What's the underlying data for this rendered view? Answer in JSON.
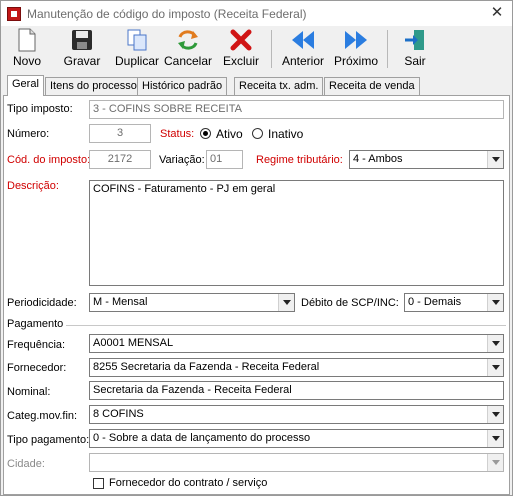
{
  "window": {
    "title": "Manutenção de código do imposto (Receita Federal)",
    "close_glyph": "✕"
  },
  "toolbar": [
    {
      "label": "Novo",
      "icon": "new-document-icon"
    },
    {
      "label": "Gravar",
      "icon": "save-disk-icon"
    },
    {
      "label": "Duplicar",
      "icon": "duplicate-icon"
    },
    {
      "label": "Cancelar",
      "icon": "cancel-arrows-icon"
    },
    {
      "label": "Excluir",
      "icon": "delete-x-icon"
    },
    {
      "label": "Anterior",
      "icon": "previous-arrow-icon"
    },
    {
      "label": "Próximo",
      "icon": "next-arrow-icon"
    },
    {
      "label": "Sair",
      "icon": "exit-door-icon"
    }
  ],
  "tabs": [
    "Geral",
    "Itens do processo",
    "Histórico padrão",
    "Receita tx. adm.",
    "Receita de venda"
  ],
  "form": {
    "tipo_imposto_label": "Tipo imposto:",
    "tipo_imposto_value": "3 - COFINS SOBRE RECEITA",
    "numero_label": "Número:",
    "numero_value": "3",
    "status_label": "Status:",
    "status_ativo": "Ativo",
    "status_inativo": "Inativo",
    "cod_imposto_label": "Cód. do imposto:",
    "cod_imposto_value": "2172",
    "variacao_label": "Variação:",
    "variacao_value": "01",
    "regime_label": "Regime tributário:",
    "regime_value": "4 - Ambos",
    "descricao_label": "Descrição:",
    "descricao_value": "COFINS - Faturamento - PJ em geral",
    "periodicidade_label": "Periodicidade:",
    "periodicidade_value": "M - Mensal",
    "debito_label": "Débito de SCP/INC:",
    "debito_value": "0 - Demais",
    "pagamento_group": "Pagamento",
    "frequencia_label": "Frequência:",
    "frequencia_value": "A0001  MENSAL",
    "fornecedor_label": "Fornecedor:",
    "fornecedor_value": "8255  Secretaria da Fazenda - Receita Federal",
    "nominal_label": "Nominal:",
    "nominal_value": "Secretaria da Fazenda - Receita Federal",
    "categ_label": "Categ.mov.fin:",
    "categ_value": "8  COFINS",
    "tipo_pag_label": "Tipo pagamento:",
    "tipo_pag_value": "0 - Sobre a data de lançamento do processo",
    "cidade_label": "Cidade:",
    "cidade_value": "",
    "fornecedor_contrato_label": "Fornecedor do contrato / serviço"
  },
  "colors": {
    "required_label": "#d00000",
    "disabled_text": "#8a8a8a"
  }
}
